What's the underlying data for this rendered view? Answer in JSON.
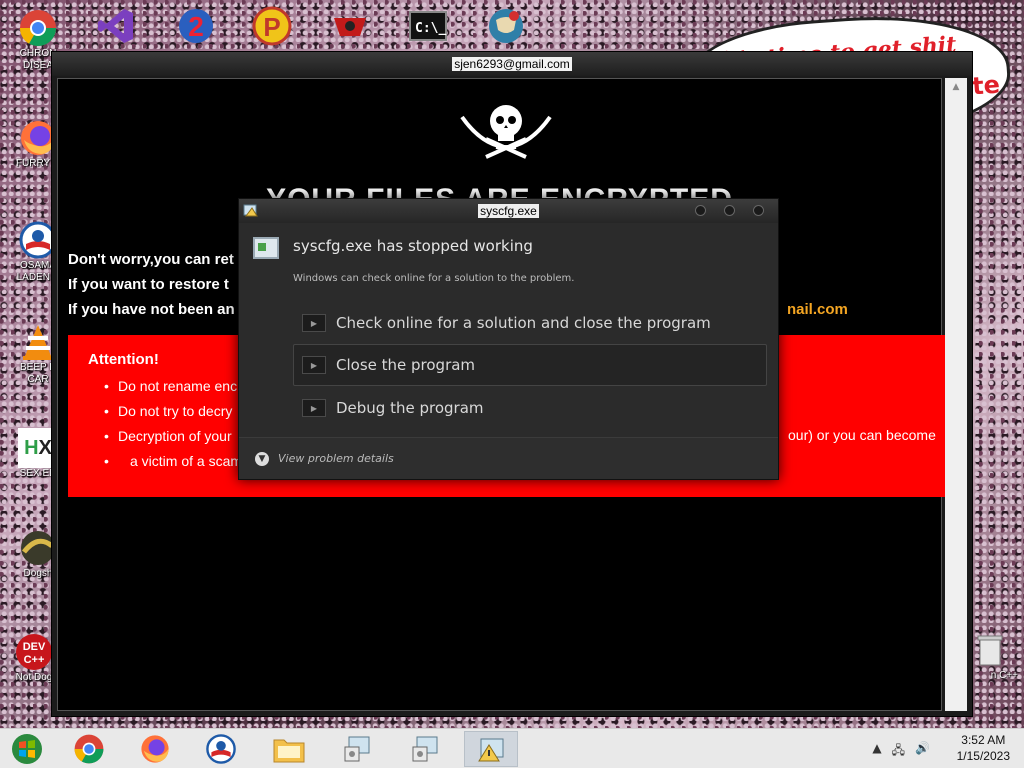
{
  "desktop": {
    "top_row_labels": [
      "CHRON",
      "DISEA"
    ],
    "icons": [
      {
        "label": "CHRON\nDISEA",
        "icon": "chrome-icon"
      },
      {
        "label": "FURRY C",
        "icon": "firefox-icon"
      },
      {
        "label": "OSAMA\nLADEN E",
        "icon": "obama-icon"
      },
      {
        "label": "BEEP B\nCAR",
        "icon": "vlc-icon"
      },
      {
        "label": "SEX ED",
        "icon": "hx-icon"
      },
      {
        "label": "Dogsh",
        "icon": "dogsh-icon"
      },
      {
        "label": "Not Dog",
        "icon": "devcpp-icon"
      }
    ],
    "right_labels": [
      "n C++"
    ],
    "bubble_text": "it's time to get shit",
    "bubble_fragment": "te"
  },
  "ransom": {
    "title": "sjen6293@gmail.com",
    "heading": "YOUR FILES ARE ENCRYPTED",
    "line1": "Don't worry,you can ret",
    "line2": "If you want to restore t",
    "line3": "If you have not been an",
    "email_fragment": "nail.com",
    "attention_title": "Attention!",
    "bullets": [
      "Do not rename enc",
      "Do not try to decry",
      "Decryption of your"
    ],
    "bullet_tail": "a victim of a scam",
    "right_fragment": "our) or you can become"
  },
  "dialog": {
    "title": "syscfg.exe",
    "heading": "syscfg.exe has stopped working",
    "subtext": "Windows can check online for a solution to the problem.",
    "options": [
      "Check online for a solution and close the program",
      "Close the program",
      "Debug the program"
    ],
    "details_label": "View problem details"
  },
  "taskbar": {
    "time": "3:52 AM",
    "date": "1/15/2023"
  },
  "colors": {
    "ransom_red": "#ff0000",
    "email_orange": "#f5a623",
    "dialog_bg": "#2b2b2b"
  }
}
